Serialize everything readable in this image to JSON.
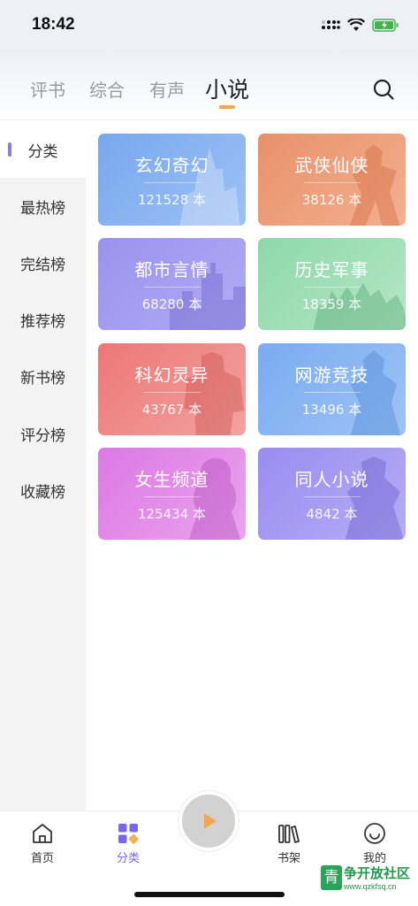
{
  "status_bar": {
    "time": "18:42"
  },
  "header": {
    "tabs": [
      {
        "label": "评书"
      },
      {
        "label": "综合"
      },
      {
        "label": "有声"
      },
      {
        "label": "小说"
      }
    ],
    "active_tab": "小说",
    "search_icon": "search-icon"
  },
  "sidebar": {
    "items": [
      {
        "label": "分类"
      },
      {
        "label": "最热榜"
      },
      {
        "label": "完结榜"
      },
      {
        "label": "推荐榜"
      },
      {
        "label": "新书榜"
      },
      {
        "label": "评分榜"
      },
      {
        "label": "收藏榜"
      }
    ],
    "active": "分类",
    "accent": "#8e78f0"
  },
  "categories": [
    {
      "name": "玄幻奇幻",
      "count": "121528 本",
      "color": "#7aa9ef"
    },
    {
      "name": "武侠仙侠",
      "count": "38126 本",
      "color": "#ee8e66"
    },
    {
      "name": "都市言情",
      "count": "68280 本",
      "color": "#9a95ee"
    },
    {
      "name": "历史军事",
      "count": "18359 本",
      "color": "#84d4a4"
    },
    {
      "name": "科幻灵异",
      "count": "43767 本",
      "color": "#ee7a78"
    },
    {
      "name": "网游竞技",
      "count": "13496 本",
      "color": "#78aaf0"
    },
    {
      "name": "女生频道",
      "count": "125434 本",
      "color": "#e37ee6"
    },
    {
      "name": "同人小说",
      "count": "4842 本",
      "color": "#9d8ff0"
    }
  ],
  "bottom_nav": {
    "items": [
      {
        "label": "首页",
        "icon": "home-icon"
      },
      {
        "label": "分类",
        "icon": "category-icon"
      },
      {
        "label": "书架",
        "icon": "bookshelf-icon"
      },
      {
        "label": "我的",
        "icon": "profile-icon"
      }
    ],
    "active": "分类",
    "play_icon": "play-icon"
  },
  "watermark": {
    "name": "争开放社区",
    "url": "www.qzkfsq.cn",
    "logo": "青"
  }
}
